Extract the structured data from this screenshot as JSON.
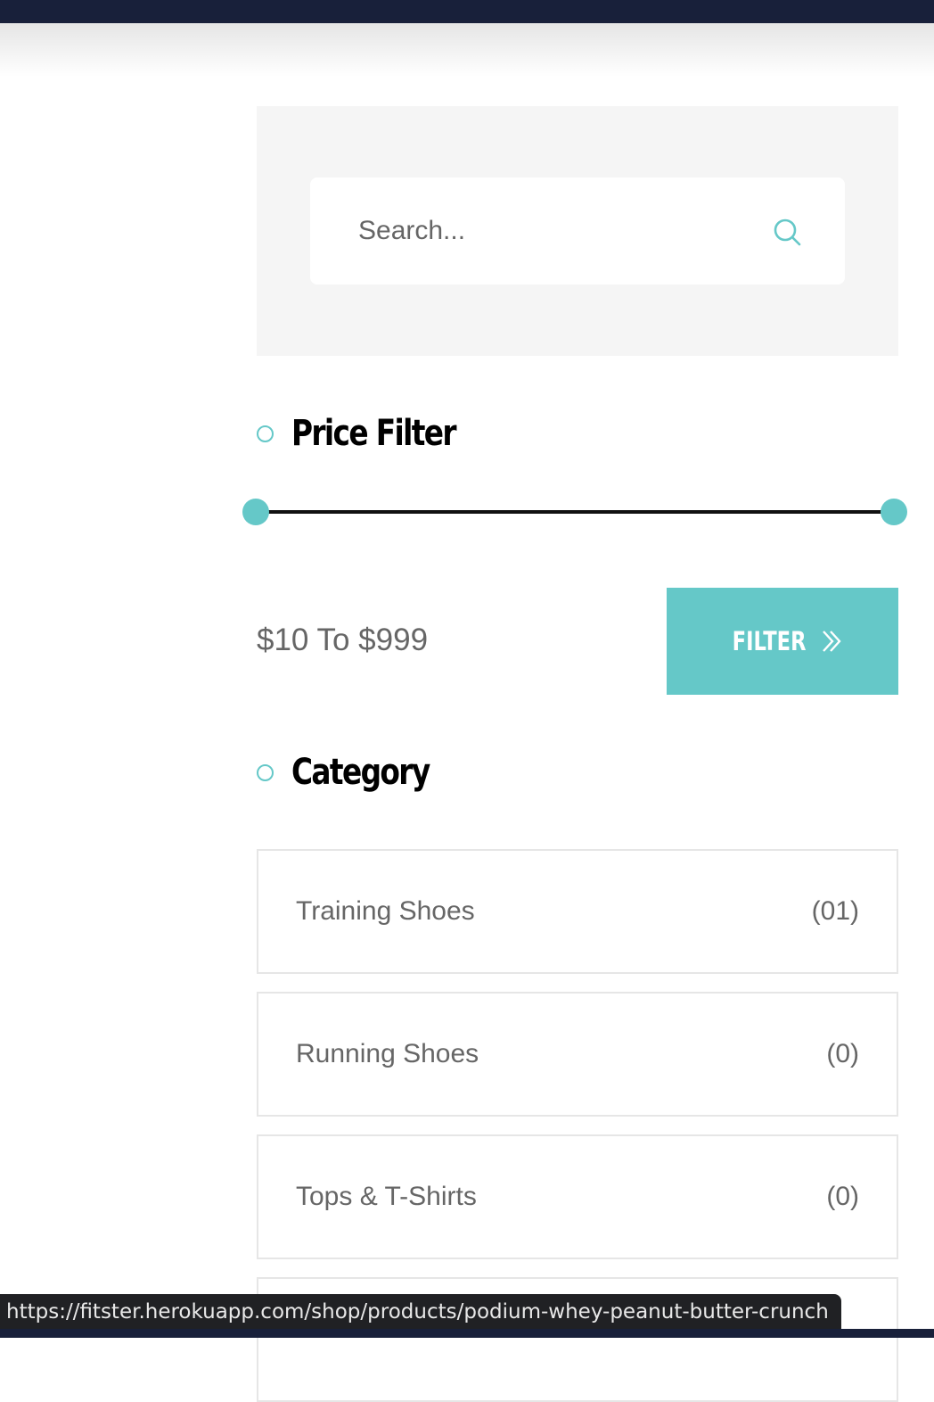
{
  "search": {
    "placeholder": "Search..."
  },
  "price_filter": {
    "title": "Price Filter",
    "min_value": 10,
    "max_value": 999,
    "range_label": "$10 To $999",
    "button_label": "FILTER"
  },
  "category": {
    "title": "Category",
    "items": [
      {
        "name": "Training Shoes",
        "count": "(01)"
      },
      {
        "name": "Running Shoes",
        "count": "(0)"
      },
      {
        "name": "Tops & T-Shirts",
        "count": "(0)"
      }
    ]
  },
  "status_bar": {
    "url": "https://fitster.herokuapp.com/shop/products/podium-whey-peanut-butter-crunch"
  },
  "colors": {
    "accent": "#65c8c8",
    "dark": "#18203a",
    "text_muted": "#666666",
    "panel_bg": "#f5f5f5"
  },
  "icons": {
    "search": "search-icon",
    "filter": "double-chevron-right-icon",
    "bullet": "circle-outline-icon"
  }
}
